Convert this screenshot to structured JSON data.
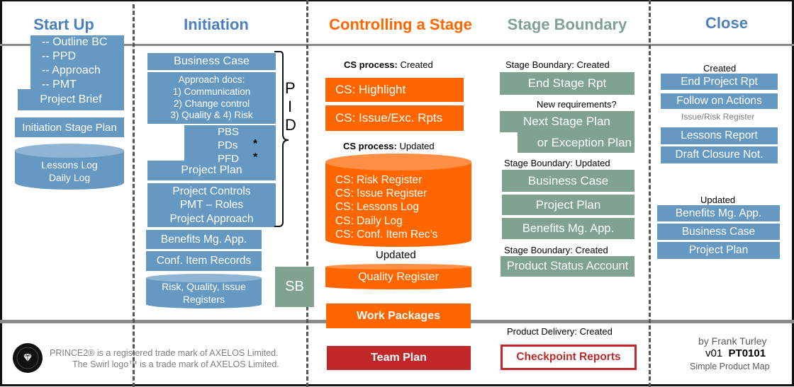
{
  "columns": {
    "start_up": "Start Up",
    "initiation": "Initiation",
    "controlling": "Controlling a Stage",
    "stage_boundary": "Stage Boundary",
    "close": "Close"
  },
  "colors": {
    "blue": "#6699c2",
    "green": "#7fa390",
    "orange": "#ff6600",
    "red": "#c0282a",
    "title_blue": "#4a80bd",
    "title_orange": "#ff6600",
    "title_green": "#7fa390"
  },
  "start_up": {
    "brief_items": [
      "-- Outline BC",
      "-- PPD",
      "-- Approach",
      "-- PMT"
    ],
    "project_brief": "Project Brief",
    "initiation_stage_plan": "Initiation Stage Plan",
    "logs": [
      "Lessons Log",
      "Daily Log"
    ]
  },
  "initiation": {
    "business_case": "Business Case",
    "approach_docs": [
      "Approach docs:",
      "1) Communication",
      "2) Change control",
      "3) Quality & 4) Risk"
    ],
    "plan_items": [
      "PBS",
      "PDs",
      "PFD"
    ],
    "asterisk": "*",
    "project_plan": "Project Plan",
    "controls": [
      "Project Controls",
      "PMT – Roles",
      "Project Approach"
    ],
    "benefits": "Benefits Mg. App.",
    "conf_items": "Conf. Item Records",
    "registers": [
      "Risk, Quality, Issue",
      "Registers"
    ],
    "pid_letters": [
      "P",
      "I",
      "D"
    ],
    "sb": "SB"
  },
  "controlling": {
    "created_label_bold": "CS process:",
    "created_label": " Created",
    "highlight": "CS:  Highlight",
    "issue_exc": "CS:  Issue/Exc. Rpts",
    "updated_label_bold": "CS process:",
    "updated_label": " Updated",
    "registers": [
      "CS: Risk Register",
      "CS: Issue  Register",
      "CS: Lessons Log",
      "CS: Daily Log",
      "CS: Conf. Item Rec’s"
    ],
    "updated2": "Updated",
    "quality_register": "Quality Register",
    "work_packages": "Work Packages",
    "team_plan": "Team Plan"
  },
  "stage_boundary": {
    "created1": "Stage Boundary: Created",
    "end_stage_rpt": "End Stage Rpt",
    "new_req": "New requirements?",
    "next_stage": "Next Stage Plan",
    "exception_plan": "or Exception Plan",
    "updated": "Stage Boundary: Updated",
    "business_case": "Business Case",
    "project_plan": "Project  Plan",
    "benefits": "Benefits Mg. App.",
    "created2": "Stage Boundary: Created",
    "product_status": "Product Status Account",
    "pd_created": "Product Delivery: Created",
    "checkpoint": "Checkpoint Reports"
  },
  "close": {
    "created": "Created",
    "end_project": "End Project Rpt",
    "follow_on": "Follow on Actions",
    "issue_risk": "Issue/Risk Register",
    "lessons": "Lessons Report",
    "draft_closure": "Draft Closure Not.",
    "updated": "Updated",
    "benefits": "Benefits Mg. App.",
    "business_case": "Business Case",
    "project_plan": "Project Plan"
  },
  "footer": {
    "trademark1": "PRINCE2® is a registered trade mark of AXELOS Limited.",
    "trademark2": "The Swirl logo™ is a trade mark of AXELOS Limited.",
    "author": "by Frank Turley",
    "version": "v01",
    "code": "PT0101",
    "subtitle": "Simple Product Map"
  }
}
